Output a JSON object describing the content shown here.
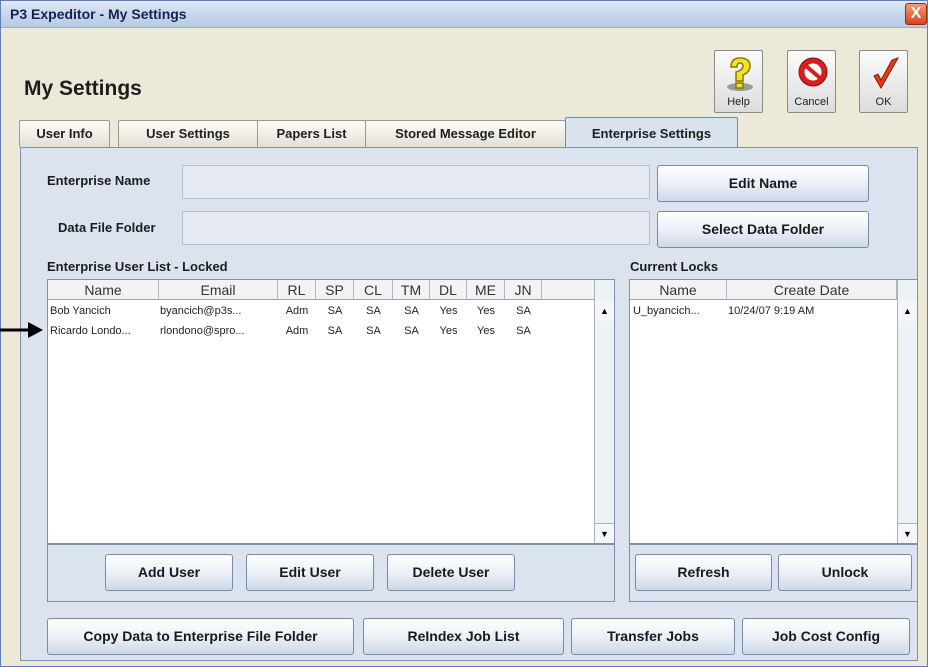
{
  "window": {
    "title": "P3 Expeditor - My Settings",
    "close_glyph": "X"
  },
  "page": {
    "title": "My Settings"
  },
  "toolbar": {
    "help": "Help",
    "cancel": "Cancel",
    "ok": "OK"
  },
  "tabs": [
    {
      "label": "User Info"
    },
    {
      "label": "User Settings"
    },
    {
      "label": "Papers List"
    },
    {
      "label": "Stored Message Editor"
    },
    {
      "label": "Enterprise Settings",
      "active": true
    }
  ],
  "enterprise": {
    "name_label": "Enterprise Name",
    "name_value": "",
    "edit_name_button": "Edit Name",
    "folder_label": "Data File Folder",
    "folder_value": "",
    "select_folder_button": "Select Data Folder"
  },
  "user_list": {
    "title": "Enterprise User List - Locked",
    "columns": [
      "Name",
      "Email",
      "RL",
      "SP",
      "CL",
      "TM",
      "DL",
      "ME",
      "JN"
    ],
    "rows": [
      [
        "Bob Yancich",
        "byancich@p3s...",
        "Adm",
        "SA",
        "SA",
        "SA",
        "Yes",
        "Yes",
        "SA"
      ],
      [
        "Ricardo Londo...",
        "rlondono@spro...",
        "Adm",
        "SA",
        "SA",
        "SA",
        "Yes",
        "Yes",
        "SA"
      ]
    ],
    "add_button": "Add User",
    "edit_button": "Edit User",
    "delete_button": "Delete User"
  },
  "locks": {
    "title": "Current Locks",
    "columns": [
      "Name",
      "Create Date"
    ],
    "rows": [
      [
        "U_byancich...",
        "10/24/07 9:19 AM"
      ]
    ],
    "refresh_button": "Refresh",
    "unlock_button": "Unlock"
  },
  "footer": {
    "copy_button": "Copy Data to Enterprise File Folder",
    "reindex_button": "ReIndex Job List",
    "transfer_button": "Transfer Jobs",
    "job_cost_button": "Job Cost Config"
  },
  "scroll": {
    "up_glyph": "▲",
    "down_glyph": "▼"
  },
  "colors": {
    "accent": "#4a6aa5",
    "panel": "#dbe3ee",
    "window": "#ece9d8"
  }
}
